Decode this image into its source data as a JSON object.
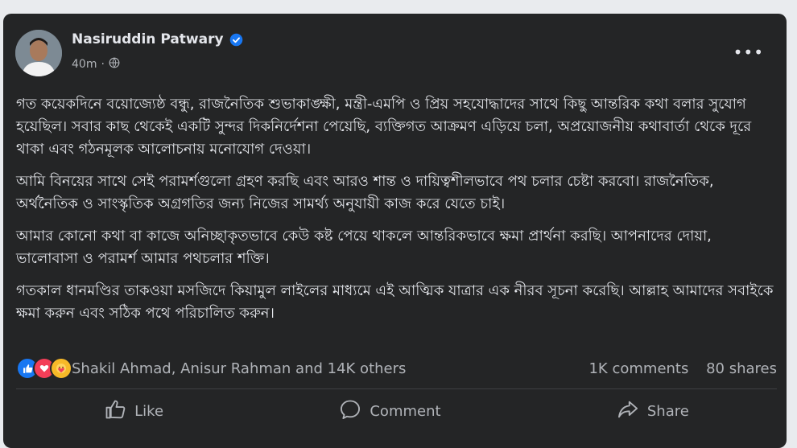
{
  "post": {
    "author": "Nasiruddin Patwary",
    "time": "40m",
    "paragraphs": [
      "গত কয়েকদিনে বয়োজ্যেষ্ঠ বন্ধু, রাজনৈতিক শুভাকাঙ্ক্ষী, মন্ত্রী-এমপি ও প্রিয় সহযোদ্ধাদের সাথে কিছু আন্তরিক কথা বলার সুযোগ হয়েছিল। সবার কাছ থেকেই একটি সুন্দর দিকনির্দেশনা পেয়েছি, ব্যক্তিগত আক্রমণ এড়িয়ে চলা, অপ্রয়োজনীয় কথাবার্তা থেকে দূরে থাকা এবং গঠনমূলক আলোচনায় মনোযোগ দেওয়া।",
      "আমি বিনয়ের সাথে সেই পরামর্শগুলো গ্রহণ করছি এবং আরও শান্ত ও দায়িত্বশীলভাবে পথ চলার চেষ্টা করবো। রাজনৈতিক, অর্থনৈতিক ও সাংস্কৃতিক অগ্রগতির জন্য নিজের সামর্থ্য অনুযায়ী কাজ করে যেতে চাই।",
      "আমার কোনো কথা বা কাজে অনিচ্ছাকৃতভাবে কেউ কষ্ট পেয়ে থাকলে আন্তরিকভাবে ক্ষমা প্রার্থনা করছি। আপনাদের দোয়া, ভালোবাসা ও পরামর্শ আমার পথচলার শক্তি।",
      "গতকাল ধানমণ্ডির তাকওয়া মসজিদে কিয়ামুল লাইলের মাধ্যমে এই আত্মিক যাত্রার এক নীরব সূচনা করেছি। আল্লাহ আমাদের সবাইকে ক্ষমা করুন এবং সঠিক পথে পরিচালিত করুন।"
    ]
  },
  "reactions": {
    "summary": "Shakil Ahmad, Anisur Rahman and 14K others",
    "comments": "1K comments",
    "shares": "80 shares",
    "icons": [
      "like-icon",
      "love-icon",
      "care-icon"
    ]
  },
  "actions": {
    "like": "Like",
    "comment": "Comment",
    "share": "Share"
  },
  "colors": {
    "card_bg": "#242526",
    "text": "#e4e6eb",
    "muted": "#b0b3b8",
    "verified": "#1877f2"
  }
}
